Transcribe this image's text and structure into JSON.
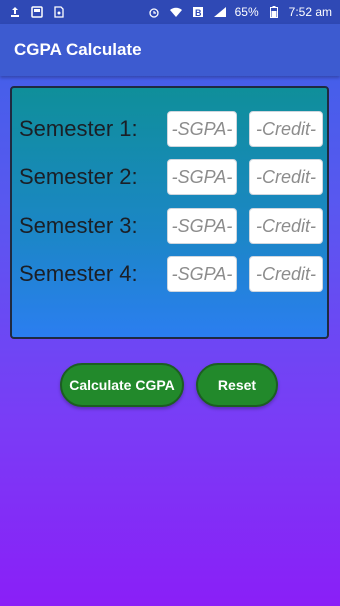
{
  "status_bar": {
    "battery": "65%",
    "time": "7:52 am",
    "icons_left": [
      "upload-icon",
      "gallery-icon",
      "sim-icon"
    ],
    "icons_right": [
      "alarm-icon",
      "wifi-icon",
      "b-icon",
      "signal-icon",
      "battery-icon"
    ]
  },
  "app_bar": {
    "title": "CGPA Calculate"
  },
  "semesters": [
    {
      "label": "Semester 1:",
      "sgpa_placeholder": "-SGPA-",
      "credit_placeholder": "-Credit-"
    },
    {
      "label": "Semester 2:",
      "sgpa_placeholder": "-SGPA-",
      "credit_placeholder": "-Credit-"
    },
    {
      "label": "Semester 3:",
      "sgpa_placeholder": "-SGPA-",
      "credit_placeholder": "-Credit-"
    },
    {
      "label": "Semester 4:",
      "sgpa_placeholder": "-SGPA-",
      "credit_placeholder": "-Credit-"
    }
  ],
  "buttons": {
    "calculate_label": "Calculate CGPA",
    "reset_label": "Reset"
  },
  "colors": {
    "app_bar": "#3d5bd0",
    "button": "#22892b",
    "card_top": "#0f8f9a",
    "card_bottom": "#2b7ef0",
    "bg_bottom": "#8a1ff7"
  }
}
